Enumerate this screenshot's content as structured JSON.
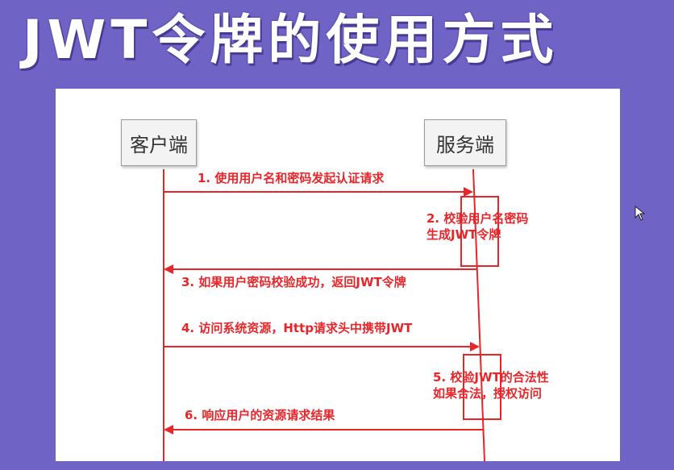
{
  "title": "JWT令牌的使用方式",
  "actors": {
    "client": "客户端",
    "server": "服务端"
  },
  "messages": [
    {
      "text": "1. 使用用户名和密码发起认证请求"
    },
    {
      "text": "3. 如果用户密码校验成功，返回JWT令牌"
    },
    {
      "text": "4. 访问系统资源，Http请求头中携带JWT"
    },
    {
      "text": "6. 响应用户的资源请求结果"
    }
  ],
  "notes": [
    {
      "lines": [
        "2. 校验用户名密码",
        "生成JWT令牌"
      ]
    },
    {
      "lines": [
        "5. 校验JWT的合法性",
        "如果合法，授权访问"
      ]
    }
  ],
  "colors": {
    "background": "#6f63c6",
    "accent": "#e8262a"
  }
}
